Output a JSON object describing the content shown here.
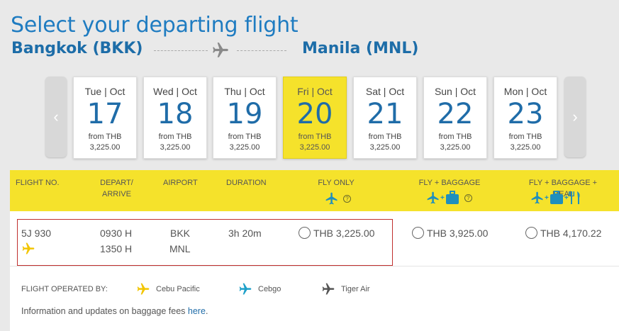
{
  "page": {
    "title": "Select your departing flight",
    "origin": "Bangkok (BKK)",
    "destination": "Manila (MNL)"
  },
  "dates": [
    {
      "dow": "Tue | Oct",
      "day": "17",
      "from": "from THB",
      "price": "3,225.00",
      "selected": false
    },
    {
      "dow": "Wed | Oct",
      "day": "18",
      "from": "from THB",
      "price": "3,225.00",
      "selected": false
    },
    {
      "dow": "Thu | Oct",
      "day": "19",
      "from": "from THB",
      "price": "3,225.00",
      "selected": false
    },
    {
      "dow": "Fri | Oct",
      "day": "20",
      "from": "from THB",
      "price": "3,225.00",
      "selected": true
    },
    {
      "dow": "Sat | Oct",
      "day": "21",
      "from": "from THB",
      "price": "3,225.00",
      "selected": false
    },
    {
      "dow": "Sun | Oct",
      "day": "22",
      "from": "from THB",
      "price": "3,225.00",
      "selected": false
    },
    {
      "dow": "Mon | Oct",
      "day": "23",
      "from": "from THB",
      "price": "3,225.00",
      "selected": false
    }
  ],
  "nav": {
    "prev": "‹",
    "next": "›"
  },
  "table": {
    "headers": {
      "flight_no": "FLIGHT NO.",
      "depart_line1": "DEPART/",
      "depart_line2": "ARRIVE",
      "airport": "AIRPORT",
      "duration": "DURATION",
      "fly_only": "FLY ONLY",
      "fly_baggage": "FLY + BAGGAGE",
      "fly_baggage_meal": "FLY + BAGGAGE + MEAL",
      "help": "?"
    },
    "flight": {
      "number": "5J 930",
      "depart": "0930 H",
      "arrive": "1350 H",
      "airport_from": "BKK",
      "airport_to": "MNL",
      "duration": "3h 20m",
      "fare_fly_only": "THB 3,225.00",
      "fare_fly_baggage": "THB 3,925.00",
      "fare_fly_baggage_meal": "THB 4,170.22"
    }
  },
  "legend": {
    "label": "FLIGHT OPERATED BY:",
    "items": [
      {
        "name": "Cebu Pacific",
        "color": "#f2c500"
      },
      {
        "name": "Cebgo",
        "color": "#1ea0c9"
      },
      {
        "name": "Tiger Air",
        "color": "#555555"
      }
    ]
  },
  "info": {
    "text": "Information and updates on baggage fees ",
    "link": "here",
    "suffix": "."
  },
  "colors": {
    "accent_yellow": "#f5e22b",
    "brand_blue": "#1f7cc1",
    "highlight_red": "#c0302e"
  }
}
